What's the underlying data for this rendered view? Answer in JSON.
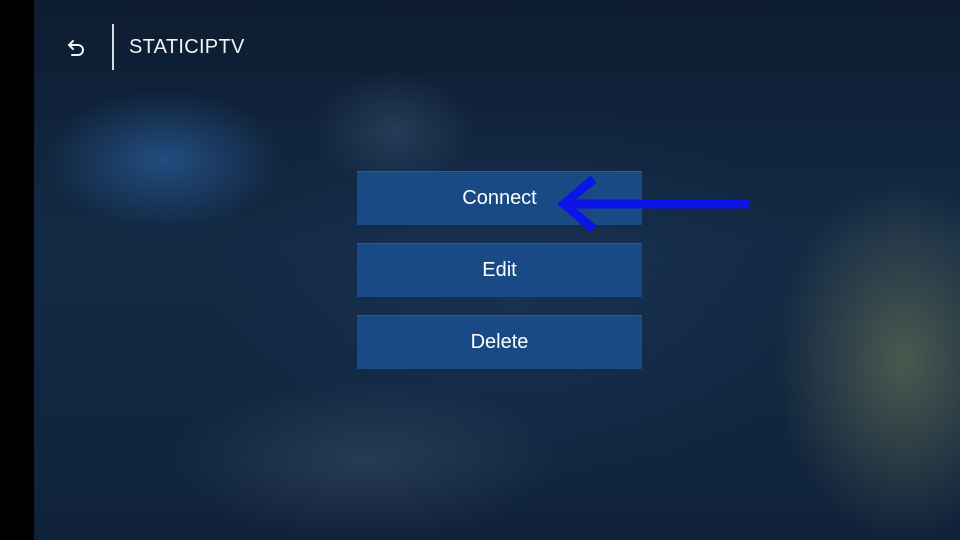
{
  "header": {
    "back_icon": "back-arrow-icon",
    "title": "STATICIPTV"
  },
  "menu": {
    "buttons": [
      {
        "label": "Connect"
      },
      {
        "label": "Edit"
      },
      {
        "label": "Delete"
      }
    ]
  },
  "annotation": {
    "arrow_icon": "left-arrow-annotation",
    "color": "#0a14e6"
  },
  "colors": {
    "button_bg": "#1a4a85",
    "background": "#132a45"
  }
}
